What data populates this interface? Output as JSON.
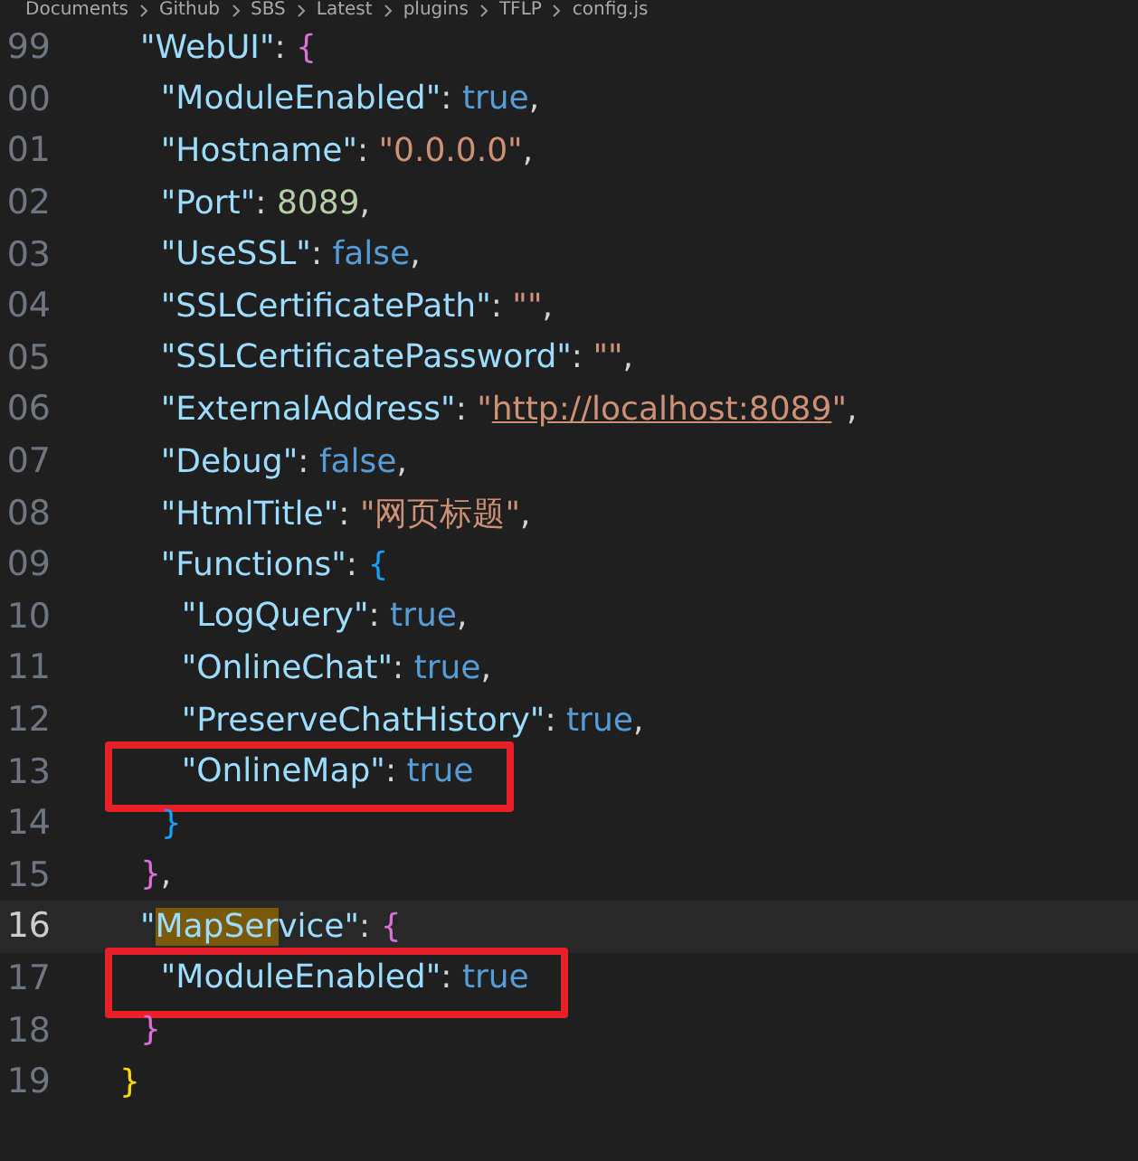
{
  "breadcrumb": [
    "Documents",
    "Github",
    "SBS",
    "Latest",
    "plugins",
    "TFLP",
    "config.js"
  ],
  "lines": [
    {
      "number": "99",
      "current": false,
      "boxed": false,
      "tokens": [
        {
          "text": "  \"WebUI\"",
          "kind": "key"
        },
        {
          "text": ": ",
          "kind": "punct"
        },
        {
          "text": "{",
          "kind": "brace2"
        }
      ]
    },
    {
      "number": "00",
      "current": false,
      "boxed": false,
      "tokens": [
        {
          "text": "    \"ModuleEnabled\"",
          "kind": "key"
        },
        {
          "text": ": ",
          "kind": "punct"
        },
        {
          "text": "true",
          "kind": "bool"
        },
        {
          "text": ",",
          "kind": "punct"
        }
      ]
    },
    {
      "number": "01",
      "current": false,
      "boxed": false,
      "tokens": [
        {
          "text": "    \"Hostname\"",
          "kind": "key"
        },
        {
          "text": ": ",
          "kind": "punct"
        },
        {
          "text": "\"0.0.0.0\"",
          "kind": "string"
        },
        {
          "text": ",",
          "kind": "punct"
        }
      ]
    },
    {
      "number": "02",
      "current": false,
      "boxed": false,
      "tokens": [
        {
          "text": "    \"Port\"",
          "kind": "key"
        },
        {
          "text": ": ",
          "kind": "punct"
        },
        {
          "text": "8089",
          "kind": "number"
        },
        {
          "text": ",",
          "kind": "punct"
        }
      ]
    },
    {
      "number": "03",
      "current": false,
      "boxed": false,
      "tokens": [
        {
          "text": "    \"UseSSL\"",
          "kind": "key"
        },
        {
          "text": ": ",
          "kind": "punct"
        },
        {
          "text": "false",
          "kind": "bool"
        },
        {
          "text": ",",
          "kind": "punct"
        }
      ]
    },
    {
      "number": "04",
      "current": false,
      "boxed": false,
      "tokens": [
        {
          "text": "    \"SSLCertificatePath\"",
          "kind": "key"
        },
        {
          "text": ": ",
          "kind": "punct"
        },
        {
          "text": "\"\"",
          "kind": "string"
        },
        {
          "text": ",",
          "kind": "punct"
        }
      ]
    },
    {
      "number": "05",
      "current": false,
      "boxed": false,
      "tokens": [
        {
          "text": "    \"SSLCertificatePassword\"",
          "kind": "key"
        },
        {
          "text": ": ",
          "kind": "punct"
        },
        {
          "text": "\"\"",
          "kind": "string"
        },
        {
          "text": ",",
          "kind": "punct"
        }
      ]
    },
    {
      "number": "06",
      "current": false,
      "boxed": false,
      "tokens": [
        {
          "text": "    \"ExternalAddress\"",
          "kind": "key"
        },
        {
          "text": ": ",
          "kind": "punct"
        },
        {
          "text": "\"",
          "kind": "string"
        },
        {
          "text": "http://localhost:8089",
          "kind": "link"
        },
        {
          "text": "\"",
          "kind": "string"
        },
        {
          "text": ",",
          "kind": "punct"
        }
      ]
    },
    {
      "number": "07",
      "current": false,
      "boxed": false,
      "tokens": [
        {
          "text": "    \"Debug\"",
          "kind": "key"
        },
        {
          "text": ": ",
          "kind": "punct"
        },
        {
          "text": "false",
          "kind": "bool"
        },
        {
          "text": ",",
          "kind": "punct"
        }
      ]
    },
    {
      "number": "08",
      "current": false,
      "boxed": false,
      "tokens": [
        {
          "text": "    \"HtmlTitle\"",
          "kind": "key"
        },
        {
          "text": ": ",
          "kind": "punct"
        },
        {
          "text": "\"网页标题\"",
          "kind": "string"
        },
        {
          "text": ",",
          "kind": "punct"
        }
      ]
    },
    {
      "number": "09",
      "current": false,
      "boxed": false,
      "tokens": [
        {
          "text": "    \"Functions\"",
          "kind": "key"
        },
        {
          "text": ": ",
          "kind": "punct"
        },
        {
          "text": "{",
          "kind": "brace3"
        }
      ]
    },
    {
      "number": "10",
      "current": false,
      "boxed": false,
      "tokens": [
        {
          "text": "      \"LogQuery\"",
          "kind": "key"
        },
        {
          "text": ": ",
          "kind": "punct"
        },
        {
          "text": "true",
          "kind": "bool"
        },
        {
          "text": ",",
          "kind": "punct"
        }
      ]
    },
    {
      "number": "11",
      "current": false,
      "boxed": false,
      "tokens": [
        {
          "text": "      \"OnlineChat\"",
          "kind": "key"
        },
        {
          "text": ": ",
          "kind": "punct"
        },
        {
          "text": "true",
          "kind": "bool"
        },
        {
          "text": ",",
          "kind": "punct"
        }
      ]
    },
    {
      "number": "12",
      "current": false,
      "boxed": false,
      "tokens": [
        {
          "text": "      \"PreserveChatHistory\"",
          "kind": "key"
        },
        {
          "text": ": ",
          "kind": "punct"
        },
        {
          "text": "true",
          "kind": "bool"
        },
        {
          "text": ",",
          "kind": "punct"
        }
      ]
    },
    {
      "number": "13",
      "current": false,
      "boxed": true,
      "tokens": [
        {
          "text": "      \"OnlineMap\"",
          "kind": "key"
        },
        {
          "text": ": ",
          "kind": "punct"
        },
        {
          "text": "true",
          "kind": "bool"
        }
      ]
    },
    {
      "number": "14",
      "current": false,
      "boxed": false,
      "tokens": [
        {
          "text": "    }",
          "kind": "brace3"
        }
      ]
    },
    {
      "number": "15",
      "current": false,
      "boxed": false,
      "tokens": [
        {
          "text": "  }",
          "kind": "brace2"
        },
        {
          "text": ",",
          "kind": "punct"
        }
      ]
    },
    {
      "number": "16",
      "current": true,
      "boxed": false,
      "tokens": [
        {
          "text": "  \"",
          "kind": "key"
        },
        {
          "text": "MapSer",
          "kind": "key",
          "highlighted": true
        },
        {
          "text": "vice\"",
          "kind": "key"
        },
        {
          "text": ": ",
          "kind": "punct"
        },
        {
          "text": "{",
          "kind": "brace2"
        }
      ]
    },
    {
      "number": "17",
      "current": false,
      "boxed": true,
      "tokens": [
        {
          "text": "    \"ModuleEnabled\"",
          "kind": "key"
        },
        {
          "text": ": ",
          "kind": "punct"
        },
        {
          "text": "true",
          "kind": "bool"
        }
      ]
    },
    {
      "number": "18",
      "current": false,
      "boxed": false,
      "tokens": [
        {
          "text": "  }",
          "kind": "brace2"
        }
      ]
    },
    {
      "number": "19",
      "current": false,
      "boxed": false,
      "tokens": [
        {
          "text": "}",
          "kind": "brace1"
        }
      ]
    }
  ]
}
